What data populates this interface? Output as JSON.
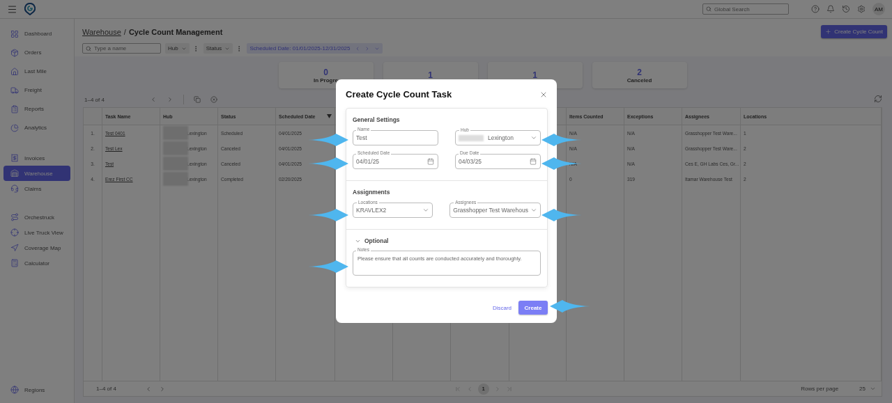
{
  "topbar": {
    "search_placeholder": "Global Search",
    "avatar": "AM"
  },
  "sidebar": {
    "groups": [
      [
        {
          "label": "Dashboard",
          "selected": false
        },
        {
          "label": "Orders",
          "selected": false
        },
        {
          "label": "Last Mile",
          "selected": false
        },
        {
          "label": "Freight",
          "selected": false
        },
        {
          "label": "Reports",
          "selected": false
        },
        {
          "label": "Analytics",
          "selected": false
        }
      ],
      [
        {
          "label": "Invoices",
          "selected": false
        },
        {
          "label": "Warehouse",
          "selected": true
        },
        {
          "label": "Claims",
          "selected": false
        }
      ],
      [
        {
          "label": "Orchestruck",
          "selected": false
        },
        {
          "label": "Live Truck View",
          "selected": false
        },
        {
          "label": "Coverage Map",
          "selected": false
        },
        {
          "label": "Calculator",
          "selected": false
        }
      ]
    ],
    "footer_item": {
      "label": "Regions",
      "selected": false
    }
  },
  "breadcrumb": {
    "parent": "Warehouse",
    "separator": "/",
    "current": "Cycle Count Management"
  },
  "filters": {
    "search_placeholder": "Type a name",
    "chips": [
      {
        "label": "Hub"
      },
      {
        "label": "Status"
      }
    ],
    "date_range": "Scheduled Date: 01/01/2025-12/31/2025"
  },
  "primary_button": "Create Cycle Count",
  "stats": [
    {
      "value": "0",
      "label": "In Progre"
    },
    {
      "value": "1"
    },
    {
      "value": "1"
    },
    {
      "value": "2",
      "label": "Canceled"
    }
  ],
  "table": {
    "range": "1–4 of 4",
    "columns": [
      {},
      {
        "label": "Task Name"
      },
      {
        "label": "Hub"
      },
      {
        "label": "Status"
      },
      {
        "label": "Scheduled Date",
        "sorted": true
      },
      {},
      {},
      {},
      {},
      {
        "label": "Items Counted"
      },
      {
        "label": "Exceptions"
      },
      {
        "label": "Assignees"
      },
      {
        "label": "Locations"
      }
    ],
    "rows": [
      {
        "cells": [
          "1.",
          "Test 0401",
          "Lexington",
          "Scheduled",
          "04/01/2025",
          null,
          null,
          null,
          null,
          "N/A",
          "N/A",
          "Grasshopper Test Ware...",
          "1"
        ]
      },
      {
        "cells": [
          "2.",
          "Test Lex",
          "Lexington",
          "Canceled",
          "04/01/2025",
          null,
          null,
          null,
          null,
          "N/A",
          "N/A",
          "Grasshopper Test Ware...",
          "2"
        ]
      },
      {
        "cells": [
          "3.",
          "Test",
          "Lexington",
          "Canceled",
          "04/01/2025",
          null,
          null,
          null,
          null,
          "N/A",
          "N/A",
          "Ces E, GH Labs Ces, Gr...",
          "2"
        ]
      },
      {
        "cells": [
          "4.",
          "Erez First CC",
          "Lexington",
          "Completed",
          "02/20/2025",
          null,
          null,
          null,
          null,
          "0",
          "319",
          "Itamar Warehouse Test",
          "2"
        ]
      }
    ],
    "footer": {
      "range": "1–4 of 4",
      "page": "1",
      "rows_per_page_label": "Rows per page",
      "rows_per_page": "25"
    }
  },
  "modal": {
    "title": "Create Cycle Count Task",
    "sections": [
      {
        "title": "General Settings",
        "fields": [
          {
            "kind": "text",
            "label": "Name",
            "value": "Test"
          },
          {
            "kind": "select",
            "label": "Hub",
            "value": "Lexington",
            "redacted": true
          },
          {
            "kind": "date",
            "label": "Scheduled Date",
            "value": "04/01/25"
          },
          {
            "kind": "date",
            "label": "Due Date",
            "value": "04/03/25"
          }
        ]
      },
      {
        "title": "Assignments",
        "fields": [
          {
            "kind": "select",
            "label": "Locations",
            "value": "KRAVLEX2"
          },
          {
            "kind": "select",
            "label": "Assignees",
            "value": "Grasshopper Test Warehous"
          }
        ]
      },
      {
        "title": "Optional",
        "expanded": true,
        "fields": [
          {
            "kind": "textarea",
            "label": "Notes",
            "value": "Please ensure that all counts are conducted accurately and thoroughly."
          }
        ]
      }
    ],
    "buttons": [
      {
        "kind": "text",
        "label": "Discard"
      },
      {
        "kind": "primary",
        "label": "Create"
      }
    ]
  }
}
